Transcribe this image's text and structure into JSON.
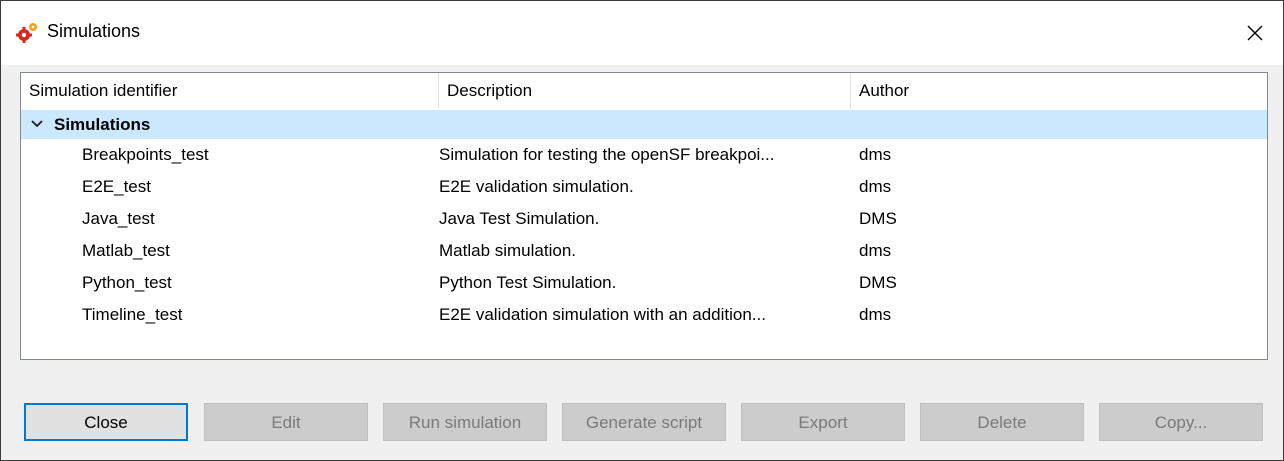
{
  "window": {
    "title": "Simulations",
    "app_icon": "gears-icon",
    "close_icon": "close-icon"
  },
  "table": {
    "columns": [
      "Simulation identifier",
      "Description",
      "Author"
    ],
    "group": {
      "label": "Simulations",
      "expanded": true,
      "icon": "chevron-down-icon"
    },
    "rows": [
      {
        "id": "Breakpoints_test",
        "description": "Simulation for testing the openSF breakpoi...",
        "author": "dms"
      },
      {
        "id": "E2E_test",
        "description": "E2E validation simulation.",
        "author": "dms"
      },
      {
        "id": "Java_test",
        "description": "Java Test Simulation.",
        "author": "DMS"
      },
      {
        "id": "Matlab_test",
        "description": "Matlab simulation.",
        "author": "dms"
      },
      {
        "id": "Python_test",
        "description": "Python Test Simulation.",
        "author": "DMS"
      },
      {
        "id": "Timeline_test",
        "description": "E2E validation simulation with an addition...",
        "author": "dms"
      }
    ]
  },
  "buttons": {
    "close": "Close",
    "edit": "Edit",
    "run": "Run simulation",
    "generate": "Generate script",
    "export": "Export",
    "delete": "Delete",
    "copy": "Copy..."
  },
  "colors": {
    "selection": "#cce8ff",
    "focus_border": "#0078d7",
    "disabled_bg": "#cccccc",
    "disabled_text": "#7a7a7a"
  }
}
